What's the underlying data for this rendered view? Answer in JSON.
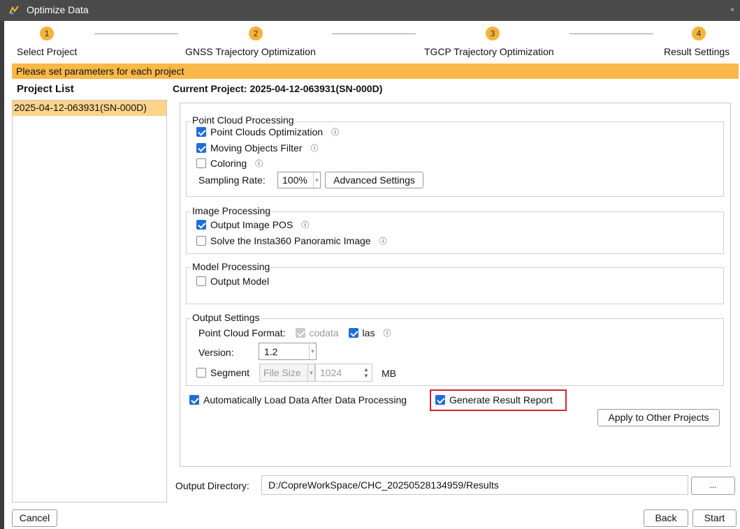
{
  "window": {
    "title": "Optimize Data",
    "close_glyph": "×"
  },
  "steps": [
    {
      "number": "1",
      "label": "Select Project"
    },
    {
      "number": "2",
      "label": "GNSS Trajectory Optimization"
    },
    {
      "number": "3",
      "label": "TGCP Trajectory Optimization"
    },
    {
      "number": "4",
      "label": "Result Settings"
    }
  ],
  "banner": "Please set parameters for each project",
  "project_list": {
    "title": "Project List",
    "items": [
      "2025-04-12-063931(SN-000D)"
    ]
  },
  "current_project": "Current Project: 2025-04-12-063931(SN-000D)",
  "point_cloud": {
    "title": "Point Cloud Processing",
    "optimization": {
      "label": "Point Clouds Optimization",
      "checked": true
    },
    "moving_filter": {
      "label": "Moving Objects Filter",
      "checked": true
    },
    "coloring": {
      "label": "Coloring",
      "checked": false
    },
    "sampling_label": "Sampling Rate:",
    "sampling_value": "100%",
    "advanced_label": "Advanced Settings"
  },
  "image_processing": {
    "title": "Image Processing",
    "output_pos": {
      "label": "Output Image POS",
      "checked": true
    },
    "insta360": {
      "label": "Solve the Insta360 Panoramic Image",
      "checked": false
    }
  },
  "model_processing": {
    "title": "Model Processing",
    "output_model": {
      "label": "Output Model",
      "checked": false
    }
  },
  "output_settings": {
    "title": "Output Settings",
    "format_label": "Point Cloud Format:",
    "codata_label": "codata",
    "las_label": "las",
    "version_label": "Version:",
    "version_value": "1.2",
    "segment_label": "Segment",
    "segment_mode": "File Size",
    "segment_size": "1024",
    "segment_unit": "MB"
  },
  "auto_load": {
    "label": "Automatically Load Data After Data Processing",
    "checked": true
  },
  "generate_report": {
    "label": "Generate Result Report",
    "checked": true
  },
  "apply_label": "Apply to Other Projects",
  "output_dir": {
    "label": "Output Directory:",
    "value": "D:/CopreWorkSpace/CHC_20250528134959/Results",
    "browse_label": "..."
  },
  "footer": {
    "cancel": "Cancel",
    "back": "Back",
    "start": "Start"
  },
  "info_glyph": "ⓘ",
  "colors": {
    "accent": "#f7b23a",
    "banner": "#f9b847",
    "checkbox": "#1e6ed8",
    "highlight": "#d4232c"
  }
}
